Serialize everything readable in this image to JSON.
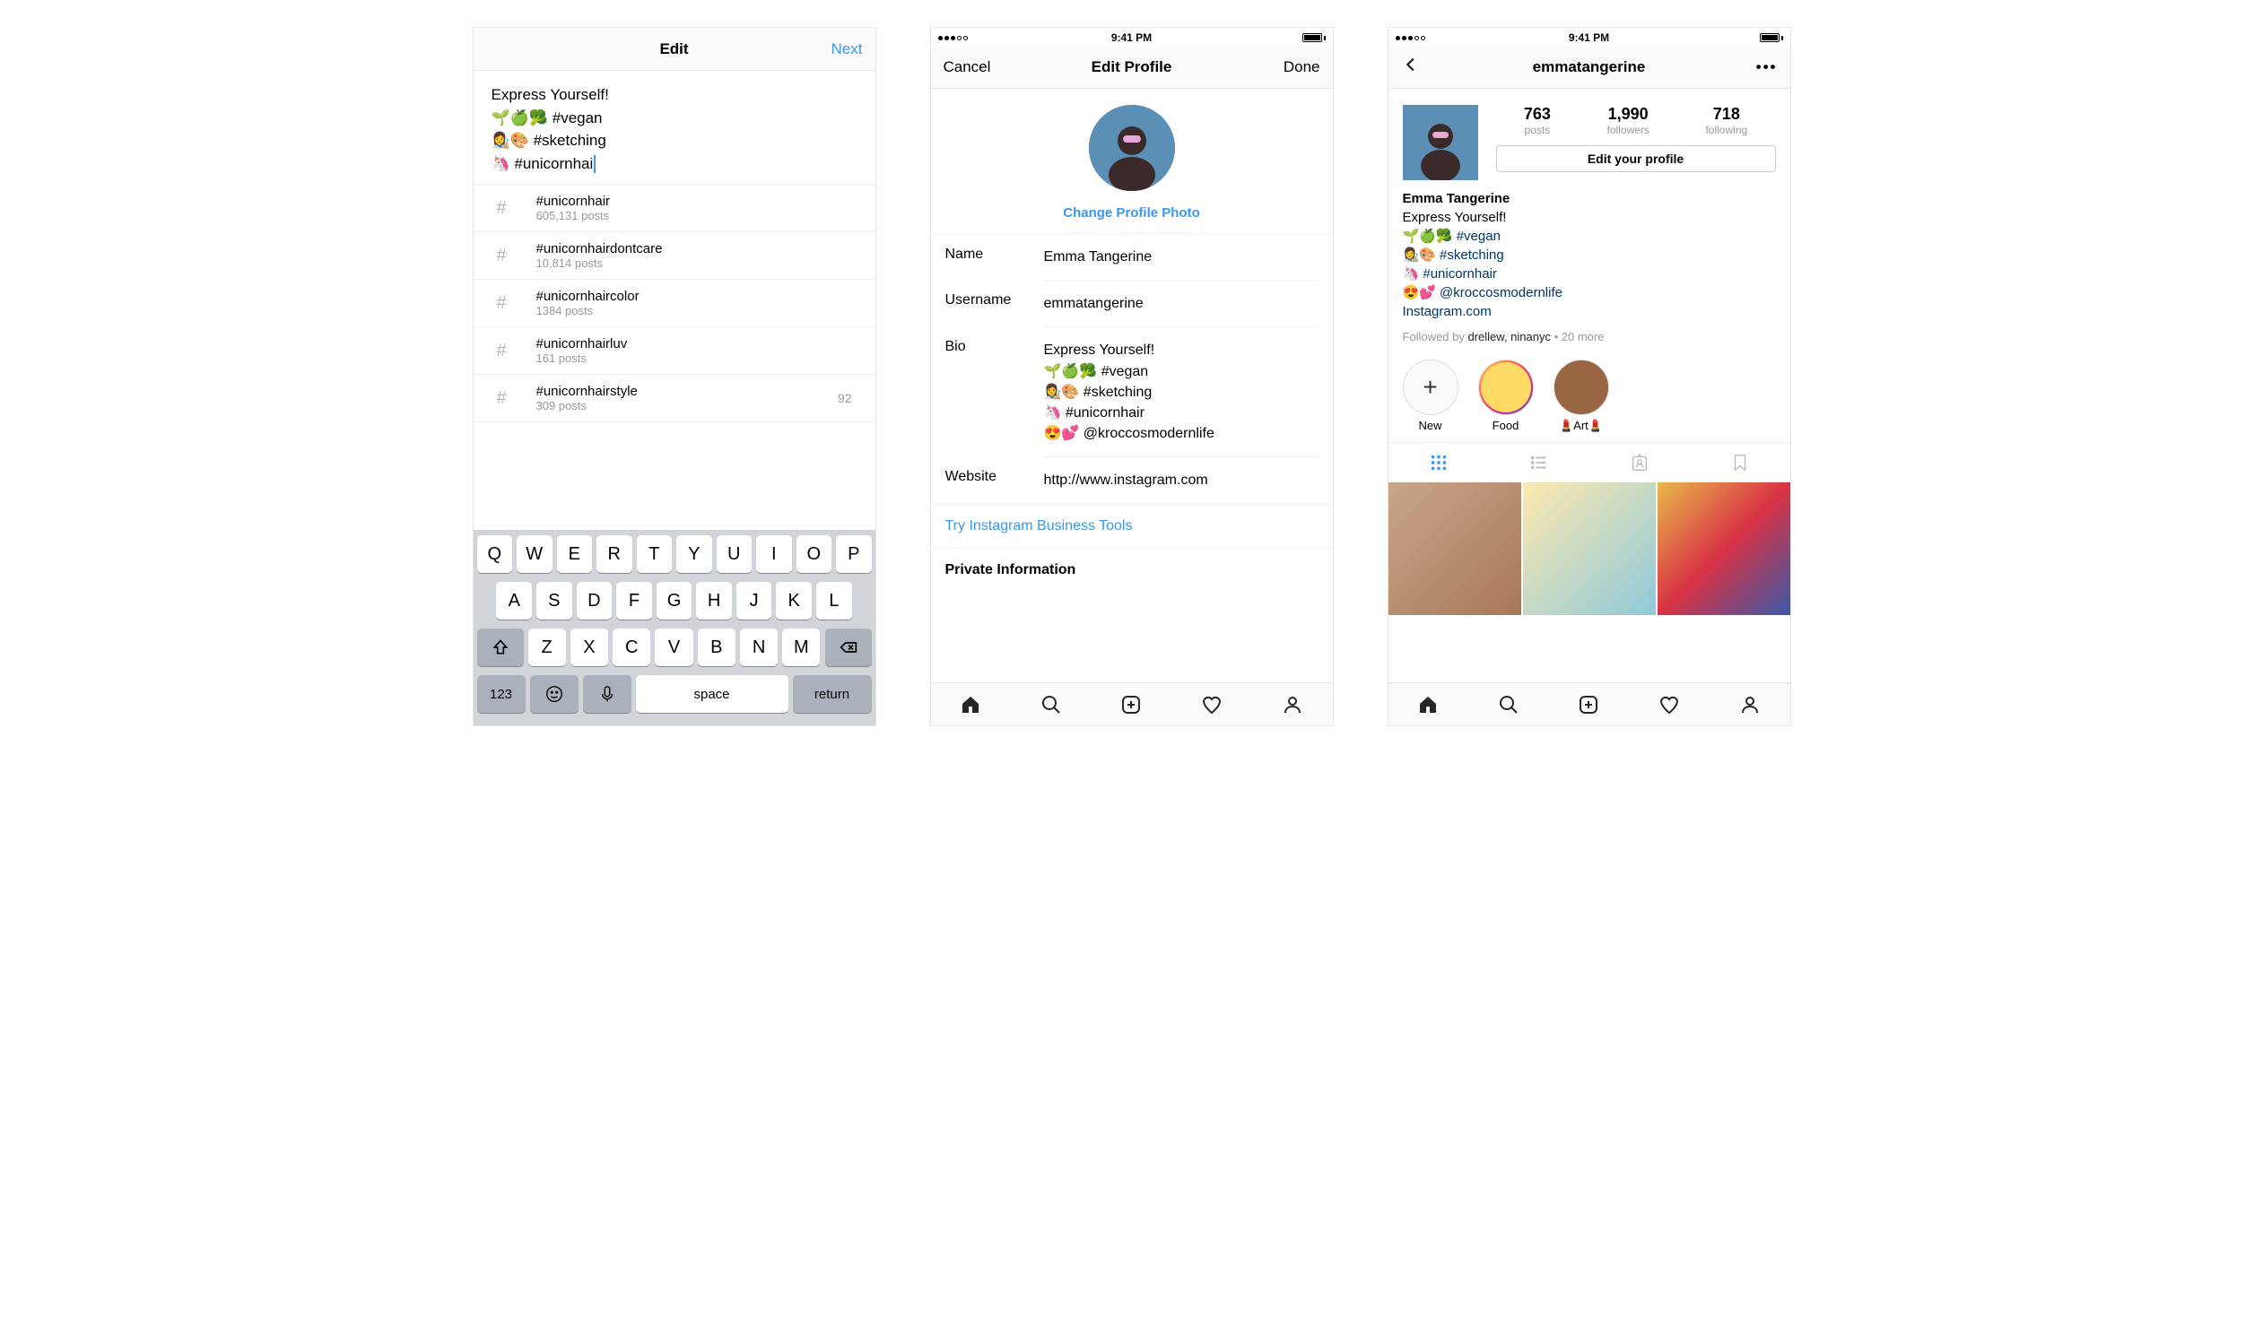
{
  "screen1": {
    "title": "Edit",
    "next": "Next",
    "bio": {
      "line1": "Express Yourself!",
      "line2_emoji": "🌱🍏🥦 ",
      "line2_tag": "#vegan",
      "line3_emoji": "👩‍🎨🎨 ",
      "line3_tag": "#sketching",
      "line4_emoji": "🦄 ",
      "line4_tag": "#unicornhai"
    },
    "suggestions": [
      {
        "tag": "#unicornhair",
        "count": "605,131 posts"
      },
      {
        "tag": "#unicornhairdontcare",
        "count": "10,814 posts"
      },
      {
        "tag": "#unicornhaircolor",
        "count": "1384 posts"
      },
      {
        "tag": "#unicornhairluv",
        "count": "161 posts"
      },
      {
        "tag": "#unicornhairstyle",
        "count": "309 posts",
        "aside": "92"
      }
    ],
    "keyboard": {
      "row1": [
        "Q",
        "W",
        "E",
        "R",
        "T",
        "Y",
        "U",
        "I",
        "O",
        "P"
      ],
      "row2": [
        "A",
        "S",
        "D",
        "F",
        "G",
        "H",
        "J",
        "K",
        "L"
      ],
      "row3": [
        "Z",
        "X",
        "C",
        "V",
        "B",
        "N",
        "M"
      ],
      "numKey": "123",
      "space": "space",
      "ret": "return"
    }
  },
  "screen2": {
    "time": "9:41 PM",
    "cancel": "Cancel",
    "title": "Edit Profile",
    "done": "Done",
    "changePhoto": "Change Profile Photo",
    "labels": {
      "name": "Name",
      "username": "Username",
      "bio": "Bio",
      "website": "Website"
    },
    "name": "Emma Tangerine",
    "username": "emmatangerine",
    "bio": {
      "l1": "Express Yourself!",
      "l2": "🌱🍏🥦 #vegan",
      "l3": "👩‍🎨🎨 #sketching",
      "l4": "🦄 #unicornhair",
      "l5": "😍💕 @kroccosmodernlife"
    },
    "website": "http://www.instagram.com",
    "businessTools": "Try Instagram Business Tools",
    "privateInfo": "Private Information"
  },
  "screen3": {
    "time": "9:41 PM",
    "username": "emmatangerine",
    "stats": {
      "posts": {
        "num": "763",
        "lbl": "posts"
      },
      "followers": {
        "num": "1,990",
        "lbl": "followers"
      },
      "following": {
        "num": "718",
        "lbl": "following"
      }
    },
    "editProfile": "Edit your profile",
    "bio": {
      "name": "Emma Tangerine",
      "l1": "Express Yourself!",
      "l2e": "🌱🍏🥦 ",
      "l2t": "#vegan",
      "l3e": "👩‍🎨🎨 ",
      "l3t": "#sketching",
      "l4e": "🦄 ",
      "l4t": "#unicornhair",
      "l5e": "😍💕 ",
      "l5t": "@kroccosmodernlife",
      "link": "Instagram.com"
    },
    "followedBy": {
      "prefix": "Followed by ",
      "names": "drellew, ninanyc",
      "suffix": " • 20 more"
    },
    "highlights": {
      "new": "New",
      "food": "Food",
      "art": "💄Art💄"
    }
  }
}
